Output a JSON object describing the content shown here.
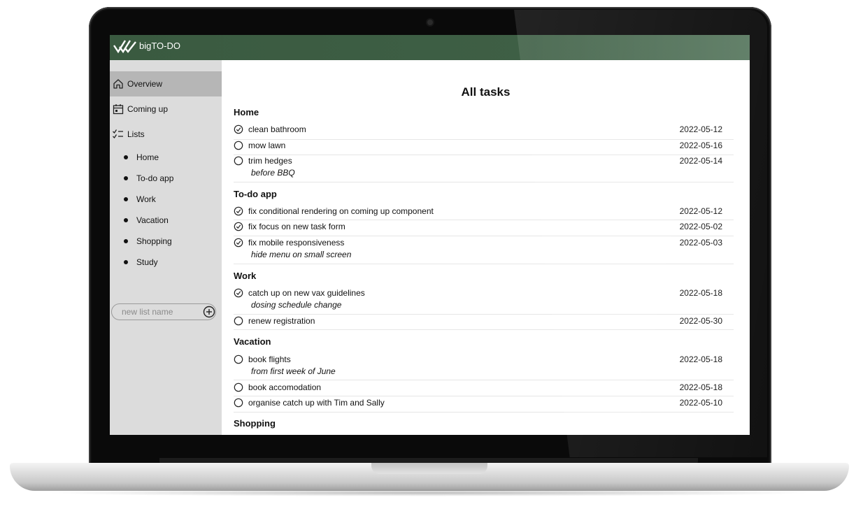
{
  "header": {
    "app_title": "bigTO-DO"
  },
  "sidebar": {
    "nav": [
      {
        "label": "Overview",
        "icon": "home-icon",
        "active": true
      },
      {
        "label": "Coming up",
        "icon": "calendar-icon",
        "active": false
      },
      {
        "label": "Lists",
        "icon": "checklist-icon",
        "active": false
      }
    ],
    "lists": [
      "Home",
      "To-do app",
      "Work",
      "Vacation",
      "Shopping",
      "Study"
    ],
    "new_list_placeholder": "new list name"
  },
  "main": {
    "title": "All tasks",
    "groups": [
      {
        "title": "Home",
        "tasks": [
          {
            "name": "clean bathroom",
            "date": "2022-05-12",
            "done": true,
            "note": ""
          },
          {
            "name": "mow lawn",
            "date": "2022-05-16",
            "done": false,
            "note": ""
          },
          {
            "name": "trim hedges",
            "date": "2022-05-14",
            "done": false,
            "note": "before BBQ"
          }
        ]
      },
      {
        "title": "To-do app",
        "tasks": [
          {
            "name": "fix conditional rendering on coming up component",
            "date": "2022-05-12",
            "done": true,
            "note": ""
          },
          {
            "name": "fix focus on new task form",
            "date": "2022-05-02",
            "done": true,
            "note": ""
          },
          {
            "name": "fix mobile responsiveness",
            "date": "2022-05-03",
            "done": true,
            "note": "hide menu on small screen"
          }
        ]
      },
      {
        "title": "Work",
        "tasks": [
          {
            "name": "catch up on new vax guidelines",
            "date": "2022-05-18",
            "done": true,
            "note": "dosing schedule change"
          },
          {
            "name": "renew registration",
            "date": "2022-05-30",
            "done": false,
            "note": ""
          }
        ]
      },
      {
        "title": "Vacation",
        "tasks": [
          {
            "name": "book flights",
            "date": "2022-05-18",
            "done": false,
            "note": "from first week of June"
          },
          {
            "name": "book accomodation",
            "date": "2022-05-18",
            "done": false,
            "note": ""
          },
          {
            "name": "organise catch up with Tim and Sally",
            "date": "2022-05-10",
            "done": false,
            "note": ""
          }
        ]
      },
      {
        "title": "Shopping",
        "tasks": []
      }
    ]
  },
  "colors": {
    "header_green": "#3a5a40",
    "sidebar_bg": "#dcdcdc",
    "sidebar_active": "#b6b6b6"
  }
}
